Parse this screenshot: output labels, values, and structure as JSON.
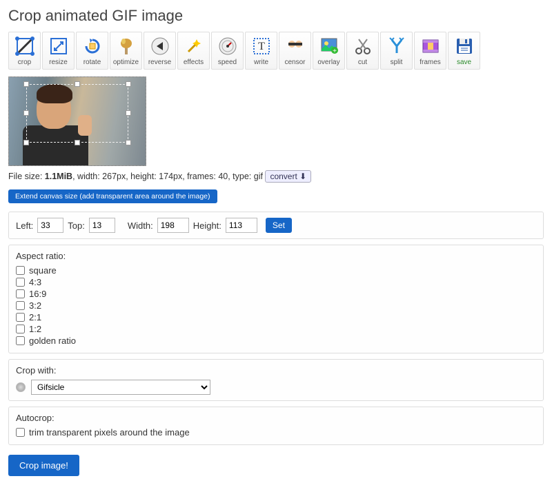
{
  "title": "Crop animated GIF image",
  "toolbar": [
    {
      "label": "crop"
    },
    {
      "label": "resize"
    },
    {
      "label": "rotate"
    },
    {
      "label": "optimize"
    },
    {
      "label": "reverse"
    },
    {
      "label": "effects"
    },
    {
      "label": "speed"
    },
    {
      "label": "write"
    },
    {
      "label": "censor"
    },
    {
      "label": "overlay"
    },
    {
      "label": "cut"
    },
    {
      "label": "split"
    },
    {
      "label": "frames"
    },
    {
      "label": "save"
    }
  ],
  "fileinfo": {
    "prefix": "File size: ",
    "size": "1.1MiB",
    "rest": ", width: 267px, height: 174px, frames: 40, type: gif",
    "convert": "convert"
  },
  "extend_label": "Extend canvas size (add transparent area around the image)",
  "dims": {
    "left_label": "Left:",
    "left": "33",
    "top_label": "Top:",
    "top": "13",
    "width_label": "Width:",
    "width": "198",
    "height_label": "Height:",
    "height": "113",
    "set": "Set"
  },
  "aspect": {
    "label": "Aspect ratio:",
    "opts": [
      "square",
      "4:3",
      "16:9",
      "3:2",
      "2:1",
      "1:2",
      "golden ratio"
    ]
  },
  "cropwith": {
    "label": "Crop with:",
    "selected": "Gifsicle"
  },
  "autocrop": {
    "label": "Autocrop:",
    "opt": "trim transparent pixels around the image"
  },
  "crop_button": "Crop image!"
}
